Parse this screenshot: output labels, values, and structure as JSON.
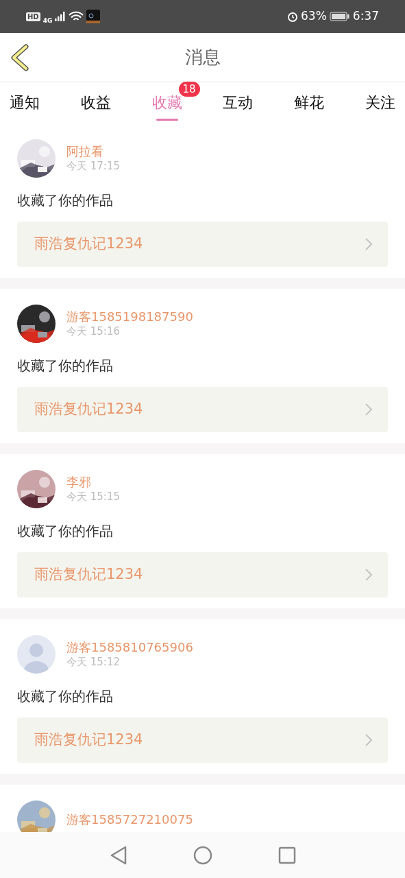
{
  "status_bar": {
    "left": [
      "HD",
      "4G"
    ],
    "battery": "63%",
    "time": "6:37"
  },
  "header": {
    "title": "消息"
  },
  "tabs": [
    {
      "label": "通知",
      "selected": false
    },
    {
      "label": "收益",
      "selected": false
    },
    {
      "label": "收藏",
      "selected": true,
      "badge": "18"
    },
    {
      "label": "互动",
      "selected": false
    },
    {
      "label": "鲜花",
      "selected": false
    },
    {
      "label": "关注",
      "selected": false
    }
  ],
  "messages": [
    {
      "user": "阿拉看",
      "time": "今天 17:15",
      "action": "收藏了你的作品",
      "work": "雨浩复仇记1234"
    },
    {
      "user": "游客1585198187590",
      "time": "今天 15:16",
      "action": "收藏了你的作品",
      "work": "雨浩复仇记1234"
    },
    {
      "user": "李邪",
      "time": "今天 15:15",
      "action": "收藏了你的作品",
      "work": "雨浩复仇记1234"
    },
    {
      "user": "游客1585810765906",
      "avatar": {
        "kind": "default"
      },
      "time": "今天 15:12",
      "action": "收藏了你的作品",
      "work": "雨浩复仇记1234"
    },
    {
      "user": "游客1585727210075"
    }
  ]
}
